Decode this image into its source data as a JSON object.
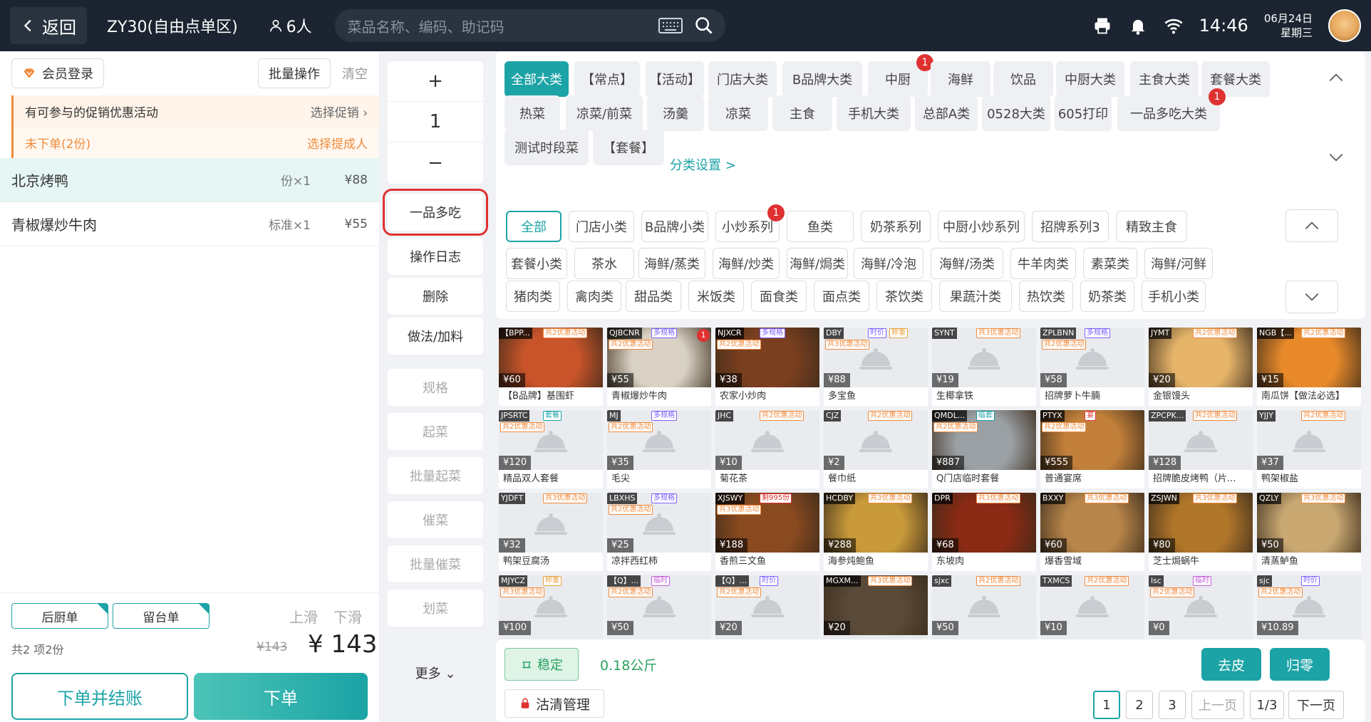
{
  "top": {
    "back": "返回",
    "table": "ZY30(自由点单区)",
    "people": "6人",
    "search_ph": "菜品名称、编码、助记码",
    "time": "14:46",
    "date": "06月24日",
    "weekday": "星期三"
  },
  "left": {
    "member": "会员登录",
    "batch": "批量操作",
    "clear": "清空",
    "promo": "有可参与的促销优惠活动",
    "promo_act": "选择促销",
    "unordered": "未下单(2份)",
    "choose_person": "选择提成人",
    "items": [
      {
        "name": "北京烤鸭",
        "qty": "份×1",
        "price": "¥88"
      },
      {
        "name": "青椒爆炒牛肉",
        "qty": "标准×1",
        "price": "¥55"
      }
    ],
    "tag1": "后厨单",
    "tag2": "留台单",
    "up": "上滑",
    "down": "下滑",
    "summary": "共2 项2份",
    "orig": "¥143",
    "total": "¥ 143",
    "btn_pay": "下单并结账",
    "btn_order": "下单"
  },
  "mid": {
    "plus": "+",
    "qty": "1",
    "minus": "−",
    "one": "一品多吃",
    "log": "操作日志",
    "del": "删除",
    "method": "做法/加料",
    "spec": "规格",
    "start": "起菜",
    "bstart": "批量起菜",
    "rush": "催菜",
    "brush": "批量催菜",
    "mark": "划菜",
    "more": "更多"
  },
  "cats": [
    [
      "全部大类",
      ""
    ],
    [
      "【常点】",
      ""
    ],
    [
      "【活动】",
      ""
    ],
    [
      "门店大类",
      ""
    ],
    [
      "B品牌大类",
      ""
    ],
    [
      "中厨",
      "1"
    ],
    [
      "海鲜",
      ""
    ],
    [
      "饮品",
      ""
    ],
    [
      "中厨大类",
      ""
    ],
    [
      "主食大类",
      ""
    ],
    [
      "套餐大类",
      ""
    ],
    [
      "热菜",
      ""
    ],
    [
      "凉菜/前菜",
      ""
    ],
    [
      "汤羹",
      ""
    ],
    [
      "凉菜",
      ""
    ],
    [
      "主食",
      ""
    ],
    [
      "手机大类",
      ""
    ],
    [
      "总部A类",
      ""
    ],
    [
      "0528大类",
      ""
    ],
    [
      "605打印",
      ""
    ],
    [
      "一品多吃大类",
      "1"
    ],
    [
      "测试时段菜",
      ""
    ],
    [
      "【套餐】",
      ""
    ]
  ],
  "cat_setting": "分类设置 >",
  "subs": [
    [
      "全部",
      ""
    ],
    [
      "门店小类",
      ""
    ],
    [
      "B品牌小类",
      ""
    ],
    [
      "小炒系列",
      "1"
    ],
    [
      "鱼类",
      ""
    ],
    [
      "奶茶系列",
      ""
    ],
    [
      "中厨小炒系列",
      ""
    ],
    [
      "招牌系列3",
      ""
    ],
    [
      "精致主食",
      ""
    ],
    [
      "套餐小类",
      ""
    ],
    [
      "茶水",
      ""
    ],
    [
      "海鲜/蒸类",
      ""
    ],
    [
      "海鲜/炒类",
      ""
    ],
    [
      "海鲜/焗类",
      ""
    ],
    [
      "海鲜/冷泡",
      ""
    ],
    [
      "海鲜/汤类",
      ""
    ],
    [
      "牛羊肉类",
      ""
    ],
    [
      "素菜类",
      ""
    ],
    [
      "海鲜/河鲜",
      ""
    ],
    [
      "猪肉类",
      ""
    ],
    [
      "禽肉类",
      ""
    ],
    [
      "甜品类",
      ""
    ],
    [
      "米饭类",
      ""
    ],
    [
      "面食类",
      ""
    ],
    [
      "面点类",
      ""
    ],
    [
      "茶饮类",
      ""
    ],
    [
      "果蔬汁类",
      ""
    ],
    [
      "热饮类",
      ""
    ],
    [
      "奶茶类",
      ""
    ],
    [
      "手机小类",
      ""
    ]
  ],
  "dishes": [
    {
      "code": "【BPP...",
      "tag": "",
      "promo": "共2优惠活动",
      "price": "¥60",
      "name": "【B品牌】基围虾",
      "color": "#c9542a",
      "badge": ""
    },
    {
      "code": "QJBCNR",
      "tag": "多规格",
      "promo": "共2优惠活动",
      "price": "¥55",
      "name": "青椒爆炒牛肉",
      "color": "#d9d2c4",
      "badge": "1"
    },
    {
      "code": "NJXCR",
      "tag": "多规格",
      "promo": "共2优惠活动",
      "price": "¥38",
      "name": "农家小炒肉",
      "color": "#7a3f1f",
      "badge": ""
    },
    {
      "code": "DBY",
      "tag": "时价",
      "tag2": "称重",
      "promo": "共3优惠活动",
      "price": "¥88",
      "name": "多宝鱼",
      "color": "",
      "badge": ""
    },
    {
      "code": "SYNT",
      "tag": "",
      "promo": "共3优惠活动",
      "price": "¥19",
      "name": "生椰拿铁",
      "color": "",
      "badge": ""
    },
    {
      "code": "ZPLBNN",
      "tag": "多规格",
      "promo": "共2优惠活动",
      "price": "¥58",
      "name": "招牌萝卜牛腩",
      "color": "",
      "badge": ""
    },
    {
      "code": "JYMT",
      "tag": "",
      "promo": "共2优惠活动",
      "price": "¥20",
      "name": "金银馒头",
      "color": "#e6b56a",
      "badge": ""
    },
    {
      "code": "NGB【...",
      "tag": "",
      "promo": "共2优惠活动",
      "price": "¥15",
      "name": "南瓜饼【做法必选】",
      "color": "#e88a2a",
      "badge": ""
    },
    {
      "code": "JPSRTC",
      "tag": "套餐",
      "promo": "共2优惠活动",
      "price": "¥120",
      "name": "精品双人套餐",
      "color": "",
      "badge": ""
    },
    {
      "code": "MJ",
      "tag": "多规格",
      "promo": "共2优惠活动",
      "price": "¥35",
      "name": "毛尖",
      "color": "",
      "badge": ""
    },
    {
      "code": "JHC",
      "tag": "",
      "promo": "共2优惠活动",
      "price": "¥10",
      "name": "菊花茶",
      "color": "",
      "badge": ""
    },
    {
      "code": "CJZ",
      "tag": "",
      "promo": "共2优惠活动",
      "price": "¥2",
      "name": "餐巾纸",
      "color": "",
      "badge": ""
    },
    {
      "code": "QMDL...",
      "tag": "临套",
      "promo": "共2优惠活动",
      "price": "¥887",
      "name": "Q门店临时套餐",
      "color": "#9aa0a4",
      "badge": ""
    },
    {
      "code": "PTYX",
      "tag": "宴",
      "promo": "共2优惠活动",
      "price": "¥555",
      "name": "普通宴席",
      "color": "#c2803a",
      "badge": ""
    },
    {
      "code": "ZPCPK...",
      "tag": "",
      "promo": "共2优惠活动",
      "price": "¥128",
      "name": "招牌脆皮烤鸭（片...",
      "color": "",
      "badge": ""
    },
    {
      "code": "YJJY",
      "tag": "",
      "promo": "共2优惠活动",
      "price": "¥37",
      "name": "鸭架椒盐",
      "color": "",
      "badge": ""
    },
    {
      "code": "YJDFT",
      "tag": "",
      "promo": "共3优惠活动",
      "price": "¥32",
      "name": "鸭架豆腐汤",
      "color": "",
      "badge": ""
    },
    {
      "code": "LBXHS",
      "tag": "多规格",
      "promo": "共2优惠活动",
      "price": "¥25",
      "name": "凉拌西红柿",
      "color": "",
      "badge": ""
    },
    {
      "code": "XJSWY",
      "tag": "剩995份",
      "promo": "共3优惠活动",
      "price": "¥188",
      "name": "香煎三文鱼",
      "color": "#8a4a20",
      "badge": ""
    },
    {
      "code": "HCDBY",
      "tag": "",
      "promo": "共3优惠活动",
      "price": "¥288",
      "name": "海参炖鲍鱼",
      "color": "#c99a3a",
      "badge": ""
    },
    {
      "code": "DPR",
      "tag": "",
      "promo": "共3优惠活动",
      "price": "¥68",
      "name": "东坡肉",
      "color": "#8a2a14",
      "badge": ""
    },
    {
      "code": "BXXY",
      "tag": "",
      "promo": "共3优惠活动",
      "price": "¥60",
      "name": "爆香雪域",
      "color": "#b8864a",
      "badge": ""
    },
    {
      "code": "ZSJWN",
      "tag": "",
      "promo": "共3优惠活动",
      "price": "¥80",
      "name": "芝士焗蜗牛",
      "color": "#b0762a",
      "badge": ""
    },
    {
      "code": "QZLY",
      "tag": "",
      "promo": "共3优惠活动",
      "price": "¥50",
      "name": "清蒸鲈鱼",
      "color": "#c9a872",
      "badge": ""
    },
    {
      "code": "MJYCZ",
      "tag": "称重",
      "promo": "共3优惠活动",
      "price": "¥100",
      "name": "",
      "color": "",
      "badge": ""
    },
    {
      "code": "【Q】...",
      "tag": "临时",
      "promo": "共2优惠活动",
      "price": "¥50",
      "name": "",
      "color": "",
      "badge": ""
    },
    {
      "code": "【Q】...",
      "tag": "时价",
      "promo": "共2优惠活动",
      "price": "¥20",
      "name": "",
      "color": "",
      "badge": ""
    },
    {
      "code": "MGXM...",
      "tag": "",
      "promo": "共3优惠活动",
      "price": "¥20",
      "name": "",
      "color": "#5a4a3a",
      "badge": ""
    },
    {
      "code": "sjxc",
      "tag": "",
      "promo": "共2优惠活动",
      "price": "¥50",
      "name": "",
      "color": "",
      "badge": ""
    },
    {
      "code": "TXMCS",
      "tag": "",
      "promo": "共2优惠活动",
      "price": "¥10",
      "name": "",
      "color": "",
      "badge": ""
    },
    {
      "code": "lsc",
      "tag": "临时",
      "promo": "共2优惠活动",
      "price": "¥0",
      "name": "",
      "color": "",
      "badge": ""
    },
    {
      "code": "sjc",
      "tag": "时价",
      "promo": "共2优惠活动",
      "price": "¥10.89",
      "name": "",
      "color": "",
      "badge": ""
    }
  ],
  "bottom": {
    "stable": "稳定",
    "weight": "0.18公斤",
    "tare": "去皮",
    "zero": "归零",
    "clean": "沽清管理",
    "pages": [
      "1",
      "2",
      "3"
    ],
    "prev": "上一页",
    "pageinfo": "1/3",
    "next": "下一页"
  }
}
